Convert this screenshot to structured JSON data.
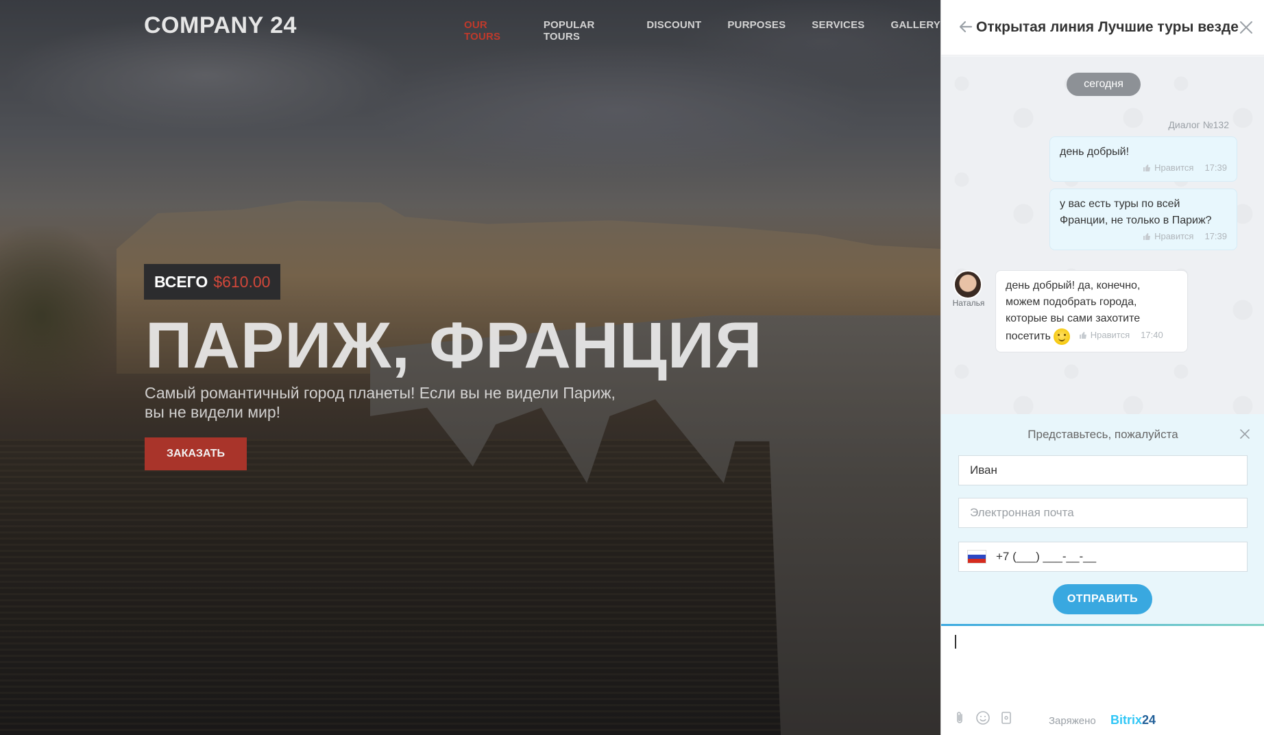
{
  "site": {
    "logo": "COMPANY 24",
    "nav": [
      {
        "label": "OUR TOURS",
        "active": true
      },
      {
        "label": "POPULAR TOURS"
      },
      {
        "label": "DISCOUNT"
      },
      {
        "label": "PURPOSES"
      },
      {
        "label": "SERVICES"
      },
      {
        "label": "GALLERY"
      }
    ],
    "hero": {
      "price_prefix": "ВСЕГО",
      "price": "$610.00",
      "title": "ПАРИЖ, ФРАНЦИЯ",
      "subtitle": "Самый романтичный город планеты! Если вы не видели Париж, вы не видели мир!",
      "cta": "ЗАКАЗАТЬ"
    },
    "colors": {
      "accent": "#c0392b",
      "badge_bg": "#2c2c2e"
    }
  },
  "chat": {
    "title": "Открытая линия Лучшие туры везде",
    "date_label": "сегодня",
    "dialog_label": "Диалог №132",
    "like_label": "Нравится",
    "messages": [
      {
        "from": "user",
        "text": "день добрый!",
        "time": "17:39"
      },
      {
        "from": "user",
        "text": "у вас есть туры по всей Франции, не только в Париж?",
        "time": "17:39"
      },
      {
        "from": "operator",
        "author": "Наталья",
        "text": "день добрый! да, конечно, можем подобрать города, которые вы сами захотите посетить",
        "time": "17:40",
        "emoji": "smile"
      }
    ],
    "form": {
      "title": "Представьтесь, пожалуйста",
      "name_value": "Иван",
      "email_placeholder": "Электронная почта",
      "phone_value": "+7 (___) ___-__-__",
      "submit": "ОТПРАВИТЬ"
    },
    "footer": {
      "powered": "Заряжено",
      "brand_a": "Bitrix",
      "brand_b": "24"
    },
    "colors": {
      "primary": "#39a8e0",
      "bubble_out": "#e8f7fd"
    }
  }
}
